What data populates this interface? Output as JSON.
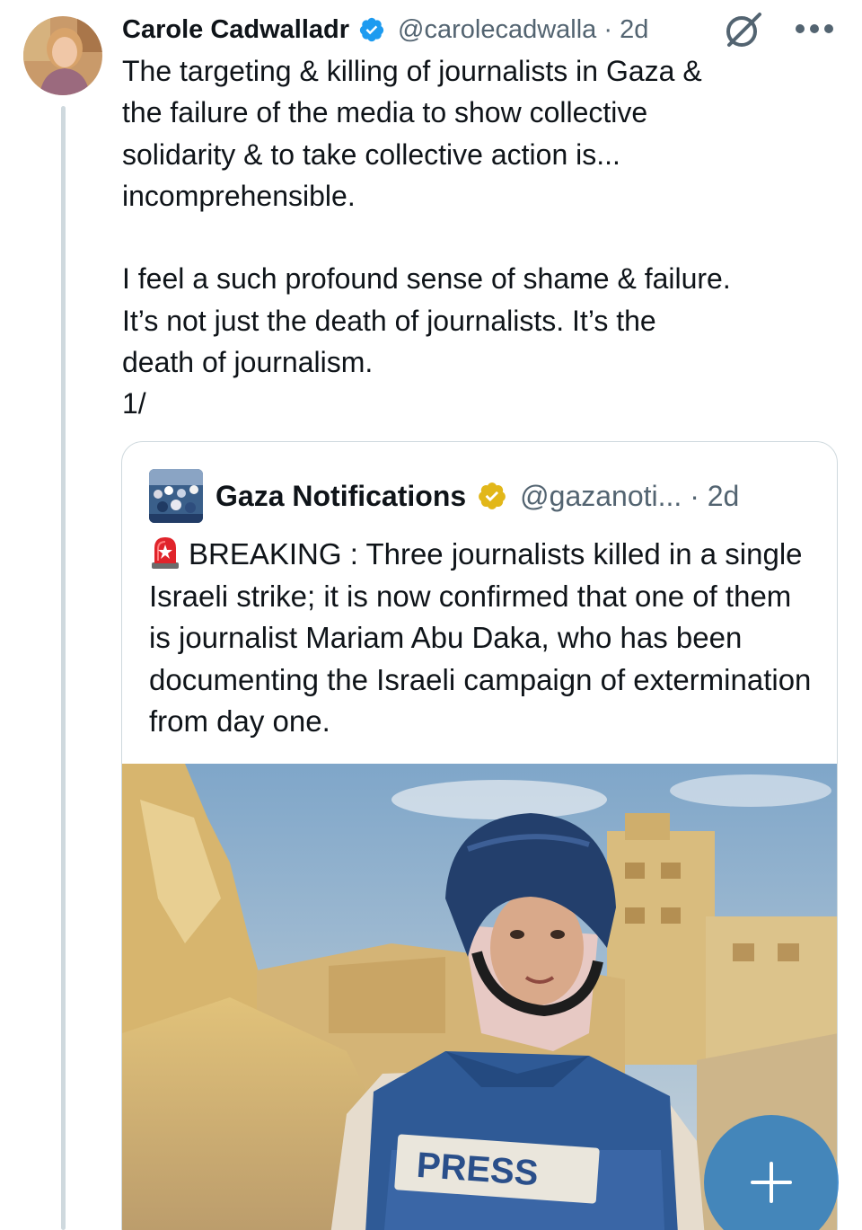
{
  "tweet": {
    "author_name": "Carole Cadwalladr",
    "handle_time": "@carolecadwalla · 2d",
    "text": "The targeting & killing of journalists in Gaza &\nthe failure of the media to show collective\nsolidarity & to take collective action is...\nincomprehensible.\n\nI feel a such profound sense of shame & failure.\nIt’s not just the death of journalists. It’s the\ndeath of journalism.\n1/",
    "icons": [
      "avatar",
      "verified-badge-blue",
      "grok-icon",
      "more-icon"
    ]
  },
  "quote": {
    "author_name": "Gaza Notifications",
    "handle_time": "@gazanoti... · 2d",
    "text": "BREAKING : Three journalists killed in a single Israeli strike; it is now confirmed that one of them is journalist Mariam Abu Daka, who has been documenting the Israeli campaign of extermination from day one.",
    "icons": [
      "siren-emoji",
      "verified-badge-gold"
    ],
    "image": {
      "vest_label": "PRESS"
    }
  },
  "fab": {
    "icon": "plus-icon"
  },
  "colors": {
    "text": "#0f1419",
    "secondary": "#536471",
    "border": "#cfd9de",
    "verified_blue": "#1d9bf0",
    "verified_gold": "#e2b719"
  }
}
